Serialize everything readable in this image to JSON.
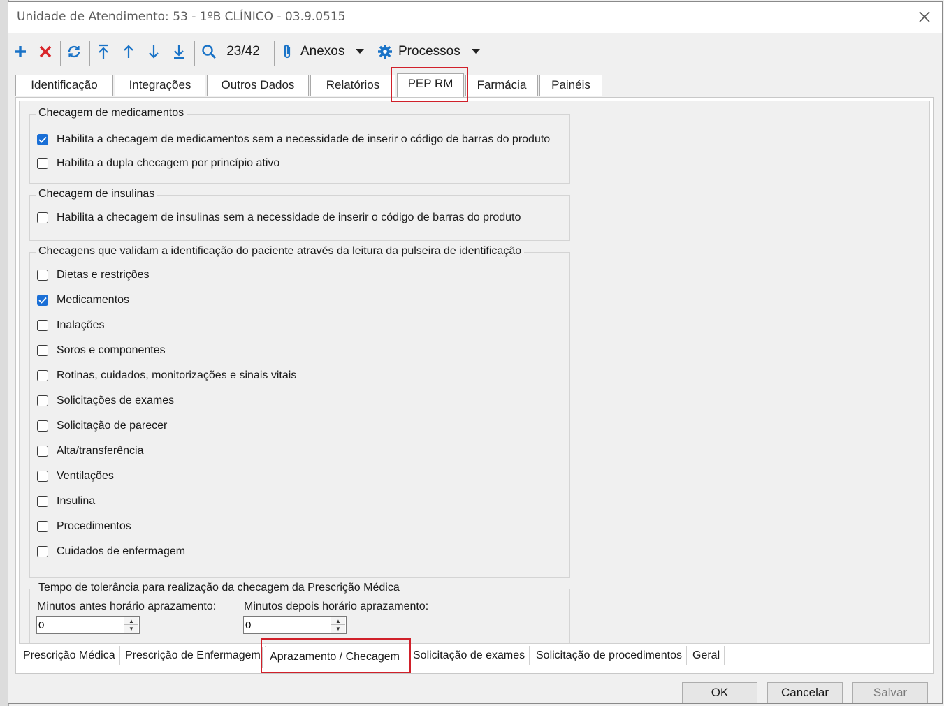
{
  "window": {
    "title": "Unidade de Atendimento: 53 - 1ºB CLÍNICO - 03.9.0515"
  },
  "toolbar": {
    "record_position": "23/42",
    "attachments_label": "Anexos",
    "processes_label": "Processos",
    "icons": [
      "add-icon",
      "delete-icon",
      "refresh-icon",
      "first-record-icon",
      "previous-record-icon",
      "next-record-icon",
      "last-record-icon",
      "search-icon",
      "paperclip-icon",
      "gear-icon"
    ]
  },
  "tabs": [
    "Identificação",
    "Integrações",
    "Outros Dados",
    "Relatórios",
    "PEP RM",
    "Farmácia",
    "Painéis"
  ],
  "active_tab": "PEP RM",
  "sections": {
    "medication": {
      "title": "Checagem de medicamentos",
      "options": [
        {
          "label": "Habilita a checagem de medicamentos sem a necessidade de inserir o código de barras do produto",
          "checked": true
        },
        {
          "label": "Habilita a dupla checagem por princípio ativo",
          "checked": false
        }
      ]
    },
    "insulin": {
      "title": "Checagem de insulinas",
      "options": [
        {
          "label": "Habilita a checagem de insulinas sem a necessidade de inserir o código de barras do produto",
          "checked": false
        }
      ]
    },
    "wristband": {
      "title": "Checagens que validam a identificação do paciente através da leitura da pulseira de identificação",
      "options": [
        {
          "label": "Dietas e restrições",
          "checked": false
        },
        {
          "label": "Medicamentos",
          "checked": true
        },
        {
          "label": "Inalações",
          "checked": false
        },
        {
          "label": "Soros e componentes",
          "checked": false
        },
        {
          "label": "Rotinas, cuidados, monitorizações e sinais vitais",
          "checked": false
        },
        {
          "label": "Solicitações de exames",
          "checked": false
        },
        {
          "label": "Solicitação de parecer",
          "checked": false
        },
        {
          "label": "Alta/transferência",
          "checked": false
        },
        {
          "label": "Ventilações",
          "checked": false
        },
        {
          "label": "Insulina",
          "checked": false
        },
        {
          "label": "Procedimentos",
          "checked": false
        },
        {
          "label": "Cuidados de enfermagem",
          "checked": false
        }
      ]
    },
    "tolerance": {
      "title": "Tempo de tolerância para realização da checagem da Prescrição Médica",
      "before_label": "Minutos antes horário aprazamento:",
      "before_value": "0",
      "after_label": "Minutos depois horário aprazamento:",
      "after_value": "0"
    }
  },
  "bottom_tabs": [
    "Prescrição Médica",
    "Prescrição de Enfermagem",
    "Aprazamento / Checagem",
    "Solicitação de exames",
    "Solicitação de procedimentos",
    "Geral"
  ],
  "active_bottom_tab": "Aprazamento / Checagem",
  "buttons": {
    "ok": "OK",
    "cancel": "Cancelar",
    "save": "Salvar"
  },
  "colors": {
    "accent": "#1a6fd6",
    "highlight": "#d0202a",
    "delete": "#d9262b",
    "icon_blue": "#1a73c7"
  }
}
